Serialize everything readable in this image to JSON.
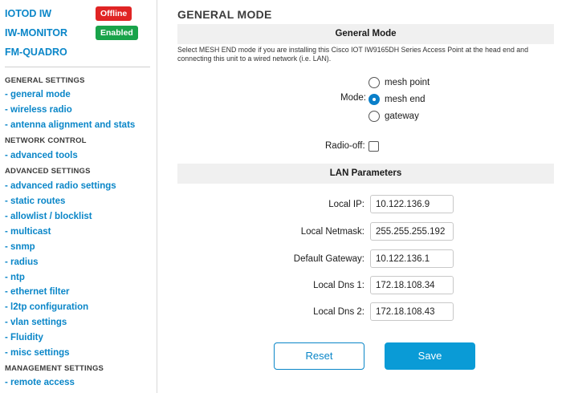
{
  "sidebar": {
    "status": [
      {
        "name": "IOTOD IW",
        "badge": "Offline",
        "badge_color": "#e02424"
      },
      {
        "name": "IW-MONITOR",
        "badge": "Enabled",
        "badge_color": "#19a34a"
      }
    ],
    "fm_quadro": "FM-QUADRO",
    "general_settings_header": "GENERAL SETTINGS",
    "general_mode": "- general mode",
    "wireless_radio": "- wireless radio",
    "antenna_alignment": "- antenna alignment and stats",
    "network_control_header": "NETWORK CONTROL",
    "advanced_tools": "- advanced tools",
    "advanced_settings_header": "ADVANCED SETTINGS",
    "advanced_radio_settings": "- advanced radio settings",
    "static_routes": "- static routes",
    "allowlist_blocklist": "- allowlist / blocklist",
    "multicast": "- multicast",
    "snmp": "- snmp",
    "radius": "- radius",
    "ntp": "- ntp",
    "ethernet_filter": "- ethernet filter",
    "l2tp_configuration": "- l2tp configuration",
    "vlan_settings": "- vlan settings",
    "fluidity": "- Fluidity",
    "misc_settings": "- misc settings",
    "management_settings_header": "MANAGEMENT SETTINGS",
    "remote_access": "- remote access"
  },
  "main": {
    "title": "GENERAL MODE",
    "general_mode_header": "General Mode",
    "description": "Select MESH END mode if you are installing this Cisco IOT IW9165DH Series Access Point at the head end and connecting this unit to a wired network (i.e. LAN).",
    "mode_label": "Mode:",
    "mode_options": [
      "mesh point",
      "mesh end",
      "gateway"
    ],
    "mode_selected": "mesh end",
    "radio_off_label": "Radio-off:",
    "radio_off_checked": false,
    "lan_header": "LAN Parameters",
    "fields": {
      "local_ip": {
        "label": "Local IP:",
        "value": "10.122.136.9"
      },
      "local_netmask": {
        "label": "Local Netmask:",
        "value": "255.255.255.192"
      },
      "default_gateway": {
        "label": "Default Gateway:",
        "value": "10.122.136.1"
      },
      "local_dns1": {
        "label": "Local Dns 1:",
        "value": "172.18.108.34"
      },
      "local_dns2": {
        "label": "Local Dns 2:",
        "value": "172.18.108.43"
      }
    },
    "reset_label": "Reset",
    "save_label": "Save"
  },
  "colors": {
    "link": "#0a86c8",
    "offline": "#e02424",
    "enabled": "#19a34a",
    "save_button": "#0a9bd6"
  }
}
